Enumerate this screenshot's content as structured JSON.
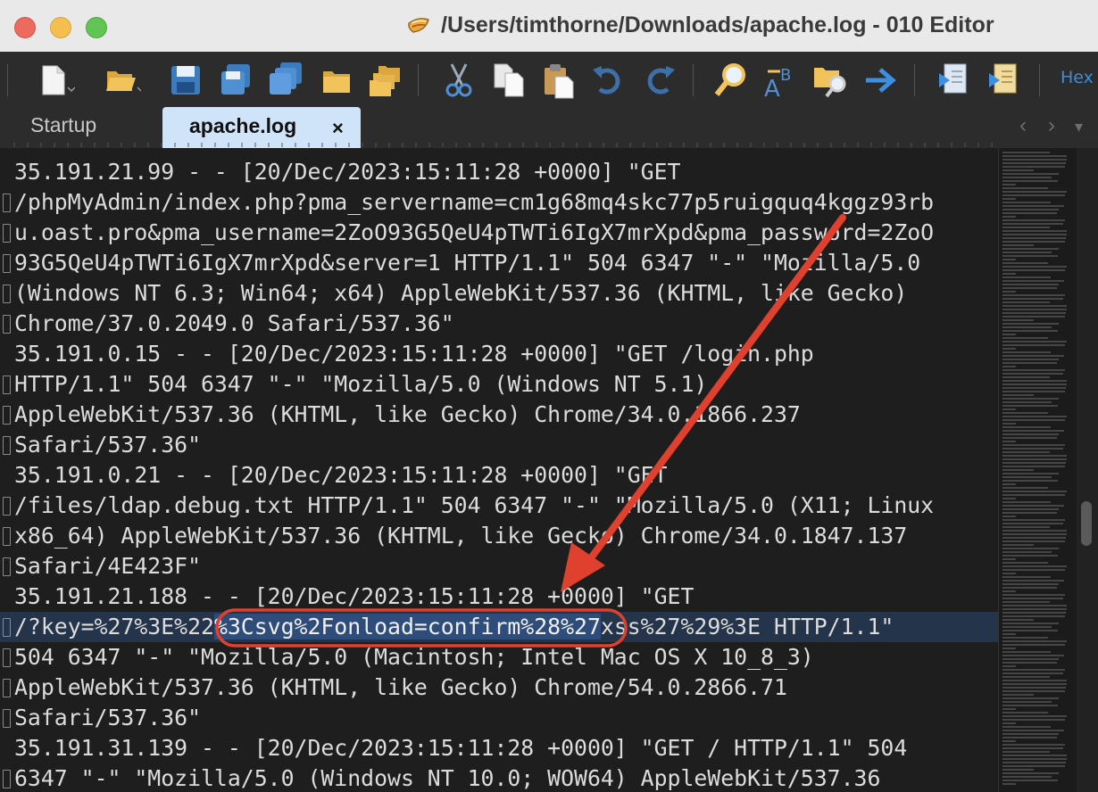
{
  "window": {
    "title": "/Users/timthorne/Downloads/apache.log - 010 Editor"
  },
  "toolbar": {
    "icons": [
      "new-file-icon",
      "open-folder-icon",
      "save-icon",
      "save-as-icon",
      "save-all-icon",
      "folder-icon",
      "open-workspace-icon",
      "cut-icon",
      "copy-icon",
      "paste-icon",
      "undo-icon",
      "redo-icon",
      "find-icon",
      "replace-icon",
      "find-in-files-icon",
      "goto-icon",
      "run-script-icon",
      "run-template-icon"
    ],
    "hex_label": "Hex"
  },
  "tabs": [
    {
      "label": "Startup",
      "active": false
    },
    {
      "label": "apache.log",
      "active": true,
      "close": "×"
    }
  ],
  "editor": {
    "lines": [
      {
        "text": "35.191.21.99 - - [20/Dec/2023:15:11:28 +0000] \"GET",
        "wrap": false
      },
      {
        "text": "/phpMyAdmin/index.php?pma_servername=cm1g68mq4skc77p5ruigquq4kggz93rb",
        "wrap": true
      },
      {
        "text": "u.oast.pro&pma_username=2ZoO93G5QeU4pTWTi6IgX7mrXpd&pma_password=2ZoO",
        "wrap": true
      },
      {
        "text": "93G5QeU4pTWTi6IgX7mrXpd&server=1 HTTP/1.1\" 504 6347 \"-\" \"Mozilla/5.0",
        "wrap": true
      },
      {
        "text": "(Windows NT 6.3; Win64; x64) AppleWebKit/537.36 (KHTML, like Gecko)",
        "wrap": true
      },
      {
        "text": "Chrome/37.0.2049.0 Safari/537.36\"",
        "wrap": true
      },
      {
        "text": "35.191.0.15 - - [20/Dec/2023:15:11:28 +0000] \"GET /login.php",
        "wrap": false
      },
      {
        "text": "HTTP/1.1\" 504 6347 \"-\" \"Mozilla/5.0 (Windows NT 5.1)",
        "wrap": true
      },
      {
        "text": "AppleWebKit/537.36 (KHTML, like Gecko) Chrome/34.0.1866.237",
        "wrap": true
      },
      {
        "text": "Safari/537.36\"",
        "wrap": true
      },
      {
        "text": "35.191.0.21 - - [20/Dec/2023:15:11:28 +0000] \"GET",
        "wrap": false
      },
      {
        "text": "/files/ldap.debug.txt HTTP/1.1\" 504 6347 \"-\" \"Mozilla/5.0 (X11; Linux",
        "wrap": true
      },
      {
        "text": "x86_64) AppleWebKit/537.36 (KHTML, like Gecko) Chrome/34.0.1847.137",
        "wrap": true
      },
      {
        "text": "Safari/4E423F\"",
        "wrap": true
      },
      {
        "text": "35.191.21.188 - - [20/Dec/2023:15:11:28 +0000] \"GET",
        "wrap": false
      },
      {
        "text_before": "/?key=%27%3E%22",
        "text_selected": "%3Csvg%2Fonload=confirm%28%27",
        "text_after": "xss%27%29%3E HTTP/1.1\"",
        "wrap": true,
        "current": true
      },
      {
        "text": "504 6347 \"-\" \"Mozilla/5.0 (Macintosh; Intel Mac OS X 10_8_3)",
        "wrap": true
      },
      {
        "text": "AppleWebKit/537.36 (KHTML, like Gecko) Chrome/54.0.2866.71",
        "wrap": true
      },
      {
        "text": "Safari/537.36\"",
        "wrap": true
      },
      {
        "text": "35.191.31.139 - - [20/Dec/2023:15:11:28 +0000] \"GET / HTTP/1.1\" 504",
        "wrap": false
      },
      {
        "text": "6347 \"-\" \"Mozilla/5.0 (Windows NT 10.0; WOW64) AppleWebKit/537.36",
        "wrap": true
      }
    ]
  },
  "colors": {
    "annotation_red": "#e0402e",
    "selection": "#2f4d7a",
    "active_tab": "#cfe3f9"
  }
}
